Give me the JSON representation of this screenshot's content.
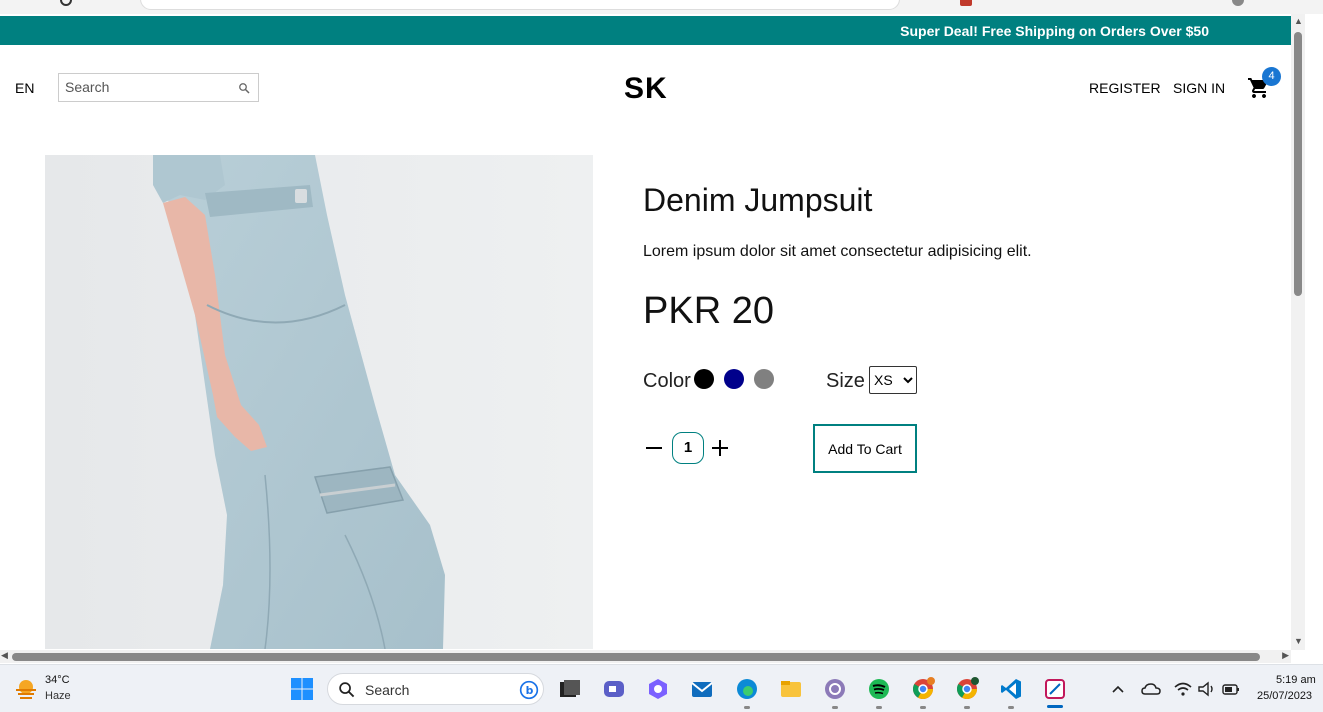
{
  "banner": {
    "text": "Super Deal! Free Shipping on Orders Over $50"
  },
  "nav": {
    "language": "EN",
    "search_placeholder": "Search",
    "logo": "SK",
    "register": "REGISTER",
    "sign_in": "SIGN IN",
    "cart_count": "4"
  },
  "product": {
    "title": "Denim Jumpsuit",
    "description": "Lorem ipsum dolor sit amet consectetur adipisicing elit.",
    "price": "PKR 20",
    "color_label": "Color",
    "colors": [
      "#000000",
      "#00008b",
      "#808080"
    ],
    "size_label": "Size",
    "size_selected": "XS",
    "quantity": "1",
    "add_to_cart": "Add To Cart"
  },
  "taskbar": {
    "weather_temp": "34°C",
    "weather_desc": "Haze",
    "search_label": "Search",
    "time": "5:19 am",
    "date": "25/07/2023"
  },
  "colors": {
    "teal": "#008080",
    "badge": "#1976d2"
  }
}
